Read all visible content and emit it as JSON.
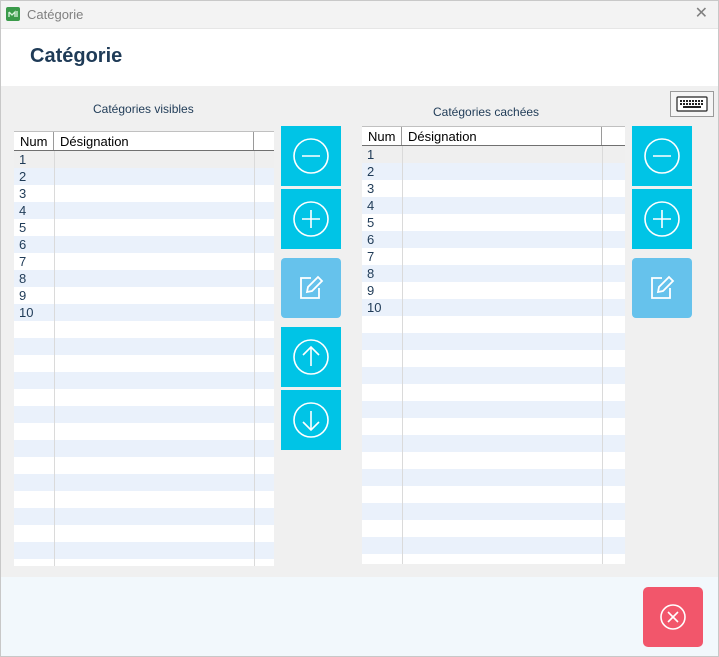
{
  "window": {
    "title": "Catégorie",
    "close_glyph": "✕"
  },
  "header": {
    "title": "Catégorie"
  },
  "visible_panel": {
    "title": "Catégories visibles",
    "columns": [
      "Num",
      "Désignation"
    ],
    "rows": [
      "1",
      "2",
      "3",
      "4",
      "5",
      "6",
      "7",
      "8",
      "9",
      "10"
    ]
  },
  "hidden_panel": {
    "title": "Catégories cachées",
    "columns": [
      "Num",
      "Désignation"
    ],
    "rows": [
      "1",
      "2",
      "3",
      "4",
      "5",
      "6",
      "7",
      "8",
      "9",
      "10"
    ]
  },
  "icons": {
    "remove": "minus-circle-icon",
    "add": "plus-circle-icon",
    "edit": "edit-icon",
    "up": "arrow-up-circle-icon",
    "down": "arrow-down-circle-icon",
    "cancel": "close-circle-icon",
    "keyboard": "keyboard-icon"
  },
  "colors": {
    "accent": "#00c4e6",
    "edit": "#66c2ec",
    "cancel": "#f2566b",
    "title": "#1f3b57"
  }
}
